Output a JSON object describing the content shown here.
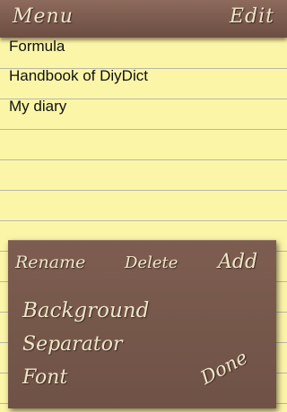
{
  "topbar": {
    "menu_label": "Menu",
    "edit_label": "Edit"
  },
  "list": {
    "items": [
      {
        "label": "Formula"
      },
      {
        "label": "Handbook of DiyDict"
      },
      {
        "label": "My diary"
      }
    ]
  },
  "panel": {
    "rename_label": "Rename",
    "delete_label": "Delete",
    "add_label": "Add",
    "background_label": "Background",
    "separator_label": "Separator",
    "font_label": "Font",
    "done_label": "Done"
  },
  "colors": {
    "paper": "#fbf5a8",
    "rule_line": "#b9b6a8",
    "bar_brown": "#7a5a4d",
    "label_cream": "#efe6c9"
  }
}
